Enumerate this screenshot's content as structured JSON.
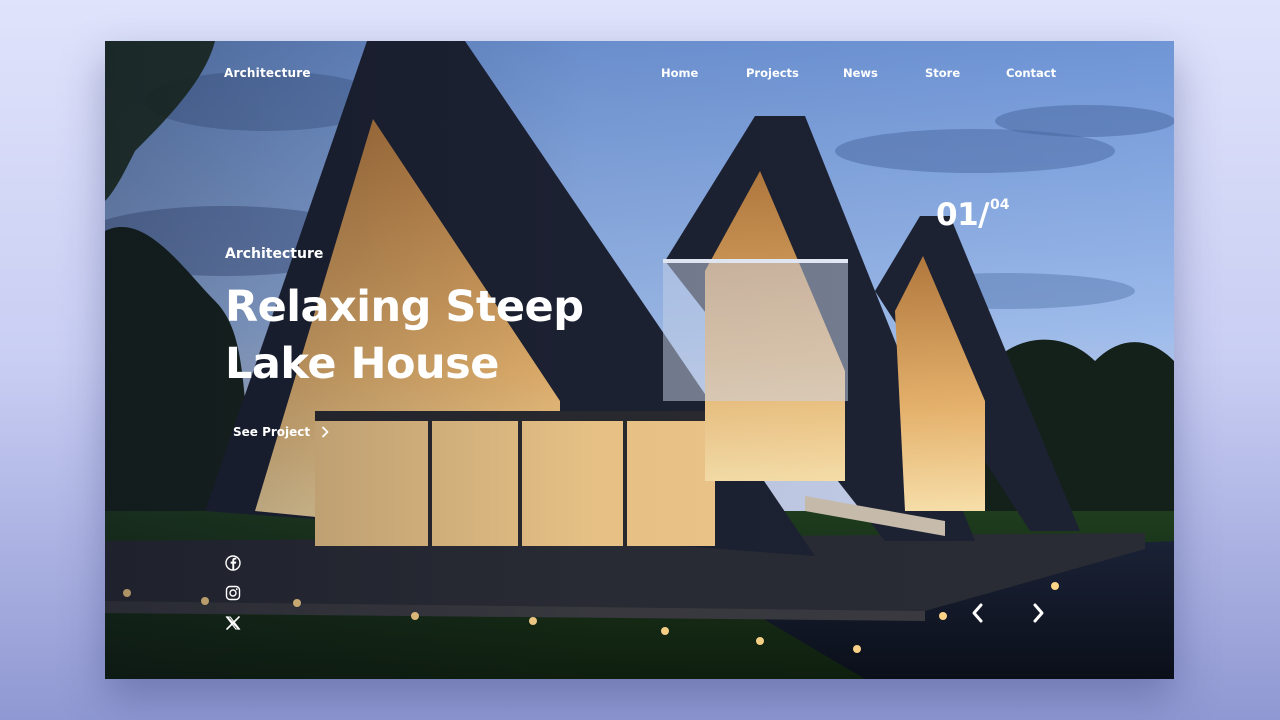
{
  "header": {
    "brand": "Architecture",
    "nav": [
      "Home",
      "Projects",
      "News",
      "Store",
      "Contact"
    ]
  },
  "hero": {
    "eyebrow": "Architecture",
    "title_line1": "Relaxing Steep",
    "title_line2": "Lake House",
    "cta_label": "See Project"
  },
  "slider": {
    "current": "01/",
    "total": "04"
  },
  "social": [
    "facebook-icon",
    "instagram-icon",
    "x-icon"
  ],
  "colors": {
    "text": "#ffffff",
    "sky": "#8fb1e6",
    "roof": "#1e2435",
    "interior_glow": "#f4c27a",
    "page_background": "#c9cef3"
  }
}
